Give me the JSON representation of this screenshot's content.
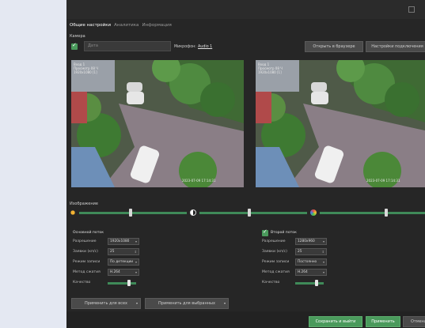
{
  "tabs": [
    "Общие настройки",
    "Аналитика",
    "Информация"
  ],
  "camera": {
    "section_label": "Камера",
    "name_placeholder": "Дата",
    "microphone_label": "Микрофон:",
    "microphone_link": "Audio 1",
    "open_browser_button": "Открыть в браузере",
    "connection_settings_button": "Настройки подключения"
  },
  "previews": {
    "left": {
      "overlay_top": [
        "Вход 1",
        "Просмотр 08 Ч",
        "1920x1080 [1]"
      ],
      "overlay_bottom": "2023-07-09 17:14:31"
    },
    "right": {
      "overlay_top": [
        "Вход 1",
        "Просмотр 08 Ч",
        "1920x1080 [1]"
      ],
      "overlay_bottom": "2023-07-09 17:14:31"
    }
  },
  "image": {
    "section_label": "Изображение",
    "brightness_level": 0.48,
    "contrast_level": 0.46,
    "saturation_level": 0.63
  },
  "primary_stream": {
    "title": "Основной поток",
    "rows": [
      {
        "label": "Разрешение",
        "value": "1920x1080"
      },
      {
        "label": "Заявки (кп/с)",
        "value": "25"
      },
      {
        "label": "Режим записи",
        "value": "По детекции"
      },
      {
        "label": "Метод сжатия",
        "value": "H.264"
      },
      {
        "label": "Качество",
        "value": ""
      }
    ],
    "quality_level": 0.75
  },
  "secondary_stream": {
    "title": "Второй поток",
    "rows": [
      {
        "label": "Разрешение",
        "value": "1280x960"
      },
      {
        "label": "Заявки (кп/с)",
        "value": "25"
      },
      {
        "label": "Режим записи",
        "value": "Постоянно"
      },
      {
        "label": "Метод сжатия",
        "value": "H.264"
      },
      {
        "label": "Качество",
        "value": ""
      }
    ],
    "quality_level": 0.75
  },
  "actions": {
    "apply_all": "Применить для всех",
    "apply_selected": "Применить для выбранных",
    "save_and_exit": "Сохранить и выйти",
    "apply": "Применить",
    "cancel": "Отмена"
  },
  "colors": {
    "accent": "#4a9a5c",
    "background": "#262626"
  }
}
